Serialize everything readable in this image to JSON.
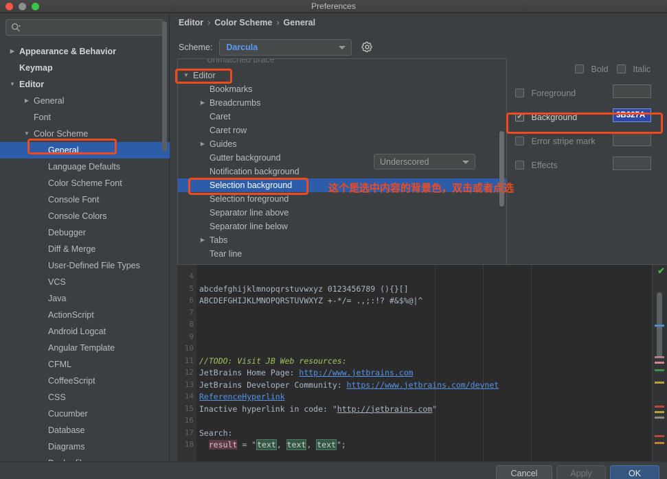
{
  "window": {
    "title": "Preferences",
    "traffic": [
      "close-button",
      "minimize-button",
      "zoom-button"
    ]
  },
  "sidebar": {
    "search": {
      "value": "",
      "placeholder": ""
    },
    "items": [
      {
        "label": "Appearance & Behavior",
        "indent": 0,
        "arrow": "collapsed",
        "bold": true,
        "selected": false
      },
      {
        "label": "Keymap",
        "indent": 0,
        "arrow": "none",
        "bold": true,
        "selected": false
      },
      {
        "label": "Editor",
        "indent": 0,
        "arrow": "expanded",
        "bold": true,
        "selected": false
      },
      {
        "label": "General",
        "indent": 1,
        "arrow": "collapsed",
        "bold": false,
        "selected": false
      },
      {
        "label": "Font",
        "indent": 1,
        "arrow": "none",
        "bold": false,
        "selected": false
      },
      {
        "label": "Color Scheme",
        "indent": 1,
        "arrow": "expanded",
        "bold": false,
        "selected": false
      },
      {
        "label": "General",
        "indent": 2,
        "arrow": "none",
        "bold": false,
        "selected": true
      },
      {
        "label": "Language Defaults",
        "indent": 2,
        "arrow": "none",
        "bold": false,
        "selected": false
      },
      {
        "label": "Color Scheme Font",
        "indent": 2,
        "arrow": "none",
        "bold": false,
        "selected": false
      },
      {
        "label": "Console Font",
        "indent": 2,
        "arrow": "none",
        "bold": false,
        "selected": false
      },
      {
        "label": "Console Colors",
        "indent": 2,
        "arrow": "none",
        "bold": false,
        "selected": false
      },
      {
        "label": "Debugger",
        "indent": 2,
        "arrow": "none",
        "bold": false,
        "selected": false
      },
      {
        "label": "Diff & Merge",
        "indent": 2,
        "arrow": "none",
        "bold": false,
        "selected": false
      },
      {
        "label": "User-Defined File Types",
        "indent": 2,
        "arrow": "none",
        "bold": false,
        "selected": false
      },
      {
        "label": "VCS",
        "indent": 2,
        "arrow": "none",
        "bold": false,
        "selected": false
      },
      {
        "label": "Java",
        "indent": 2,
        "arrow": "none",
        "bold": false,
        "selected": false
      },
      {
        "label": "ActionScript",
        "indent": 2,
        "arrow": "none",
        "bold": false,
        "selected": false
      },
      {
        "label": "Android Logcat",
        "indent": 2,
        "arrow": "none",
        "bold": false,
        "selected": false
      },
      {
        "label": "Angular Template",
        "indent": 2,
        "arrow": "none",
        "bold": false,
        "selected": false
      },
      {
        "label": "CFML",
        "indent": 2,
        "arrow": "none",
        "bold": false,
        "selected": false
      },
      {
        "label": "CoffeeScript",
        "indent": 2,
        "arrow": "none",
        "bold": false,
        "selected": false
      },
      {
        "label": "CSS",
        "indent": 2,
        "arrow": "none",
        "bold": false,
        "selected": false
      },
      {
        "label": "Cucumber",
        "indent": 2,
        "arrow": "none",
        "bold": false,
        "selected": false
      },
      {
        "label": "Database",
        "indent": 2,
        "arrow": "none",
        "bold": false,
        "selected": false
      },
      {
        "label": "Diagrams",
        "indent": 2,
        "arrow": "none",
        "bold": false,
        "selected": false
      },
      {
        "label": "Dockerfile",
        "indent": 2,
        "arrow": "none",
        "bold": false,
        "selected": false
      }
    ],
    "help_label": "?"
  },
  "header": {
    "breadcrumb": [
      "Editor",
      "Color Scheme",
      "General"
    ],
    "breadcrumb_sep": "›",
    "scheme_label": "Scheme:",
    "scheme_value": "Darcula"
  },
  "options": {
    "cut_off_row": "Unmatched brace",
    "rows": [
      {
        "label": "Editor",
        "indent": 0,
        "arrow": "expanded",
        "selected": false
      },
      {
        "label": "Bookmarks",
        "indent": 1,
        "arrow": "none",
        "selected": false
      },
      {
        "label": "Breadcrumbs",
        "indent": 1,
        "arrow": "collapsed",
        "selected": false
      },
      {
        "label": "Caret",
        "indent": 1,
        "arrow": "none",
        "selected": false
      },
      {
        "label": "Caret row",
        "indent": 1,
        "arrow": "none",
        "selected": false
      },
      {
        "label": "Guides",
        "indent": 1,
        "arrow": "collapsed",
        "selected": false
      },
      {
        "label": "Gutter background",
        "indent": 1,
        "arrow": "none",
        "selected": false
      },
      {
        "label": "Notification background",
        "indent": 1,
        "arrow": "none",
        "selected": false
      },
      {
        "label": "Selection background",
        "indent": 1,
        "arrow": "none",
        "selected": true
      },
      {
        "label": "Selection foreground",
        "indent": 1,
        "arrow": "none",
        "selected": false
      },
      {
        "label": "Separator line above",
        "indent": 1,
        "arrow": "none",
        "selected": false
      },
      {
        "label": "Separator line below",
        "indent": 1,
        "arrow": "none",
        "selected": false
      },
      {
        "label": "Tabs",
        "indent": 1,
        "arrow": "collapsed",
        "selected": false
      },
      {
        "label": "Tear line",
        "indent": 1,
        "arrow": "none",
        "selected": false
      }
    ]
  },
  "attributes": {
    "bold_label": "Bold",
    "bold_checked": false,
    "italic_label": "Italic",
    "italic_checked": false,
    "foreground_label": "Foreground",
    "foreground_checked": false,
    "foreground_color": "",
    "background_label": "Background",
    "background_checked": true,
    "background_color": "3B327A",
    "background_swatch_hex": "#2c47a8",
    "error_stripe_label": "Error stripe mark",
    "error_stripe_checked": false,
    "effects_label": "Effects",
    "effects_checked": false,
    "effects_type": "Underscored"
  },
  "annotation": {
    "note_text": "这个是选中内容的背景色，双击或者点选",
    "highlight_color": "#ef4b20"
  },
  "preview": {
    "lines": [
      {
        "num": "4",
        "type": "blank"
      },
      {
        "num": "5",
        "type": "plain",
        "text": "abcdefghijklmnopqrstuvwxyz 0123456789 (){}[]"
      },
      {
        "num": "6",
        "type": "plain",
        "text": "ABCDEFGHIJKLMNOPQRSTUVWXYZ +-*/= .,;:!? #&$%@|^"
      },
      {
        "num": "7",
        "type": "blank"
      },
      {
        "num": "8",
        "type": "blank"
      },
      {
        "num": "9",
        "type": "blank"
      },
      {
        "num": "10",
        "type": "blank"
      },
      {
        "num": "11",
        "type": "comment",
        "text": "//TODO: Visit JB Web resources:"
      },
      {
        "num": "12",
        "type": "link",
        "text": "JetBrains Home Page: ",
        "link": "http://www.jetbrains.com"
      },
      {
        "num": "13",
        "type": "link",
        "text": "JetBrains Developer Community: ",
        "link": "https://www.jetbrains.com/devnet"
      },
      {
        "num": "14",
        "type": "hyperlink",
        "text": "ReferenceHyperlink"
      },
      {
        "num": "15",
        "type": "inactive",
        "text": "Inactive hyperlink in code: \"",
        "link": "http://jetbrains.com",
        "tail": "\""
      },
      {
        "num": "16",
        "type": "blank"
      },
      {
        "num": "17",
        "type": "plain",
        "text": "Search:"
      },
      {
        "num": "18",
        "type": "search",
        "result": "result",
        "eq": " = \"",
        "t1": "text",
        "sep1": ", ",
        "t2": "text",
        "sep2": ", ",
        "t3": "text",
        "tail": "\";"
      }
    ]
  },
  "footer": {
    "cancel_label": "Cancel",
    "apply_label": "Apply",
    "ok_label": "OK"
  }
}
